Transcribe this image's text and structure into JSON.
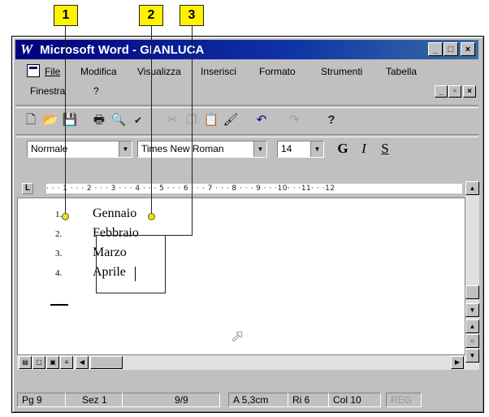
{
  "callouts": [
    "1",
    "2",
    "3"
  ],
  "window": {
    "title": "Microsoft Word - GIANLUCA",
    "app_glyph": "W",
    "controls": [
      "_",
      "□",
      "×"
    ]
  },
  "menu": {
    "items": [
      "File",
      "Modifica",
      "Visualizza",
      "Inserisci",
      "Formato",
      "Strumenti",
      "Tabella",
      "Finestra",
      "?"
    ],
    "doc_controls": [
      "_",
      "▫",
      "×"
    ]
  },
  "toolbar_standard": {
    "icons": [
      "new-icon",
      "open-icon",
      "save-icon",
      "print-icon",
      "print-preview-icon",
      "spelling-icon",
      "cut-icon",
      "copy-icon",
      "paste-icon",
      "format-painter-icon",
      "undo-icon",
      "redo-icon",
      "help-icon"
    ]
  },
  "toolbar_format": {
    "style": "Normale",
    "font": "Times New Roman",
    "size": "14",
    "bold": "G",
    "italic": "I",
    "strike": "S"
  },
  "ruler": {
    "marks": "· · · 1 · · · 2 · · · 3 · · · 4 · · · 5 · · · 6 · · · 7 · · · 8 · · · 9 · · ·10· · ·11· · ·12"
  },
  "document": {
    "list_numbers": [
      "1.",
      "2.",
      "3.",
      "4."
    ],
    "list_items": [
      "Gennaio",
      "Febbraio",
      "Marzo",
      "Aprile"
    ]
  },
  "statusbar": {
    "page": "Pg 9",
    "section": "Sez 1",
    "pages": "9/9",
    "at": "A 5,3cm",
    "line": "Ri 6",
    "col": "Col 10",
    "reg": "REG"
  }
}
